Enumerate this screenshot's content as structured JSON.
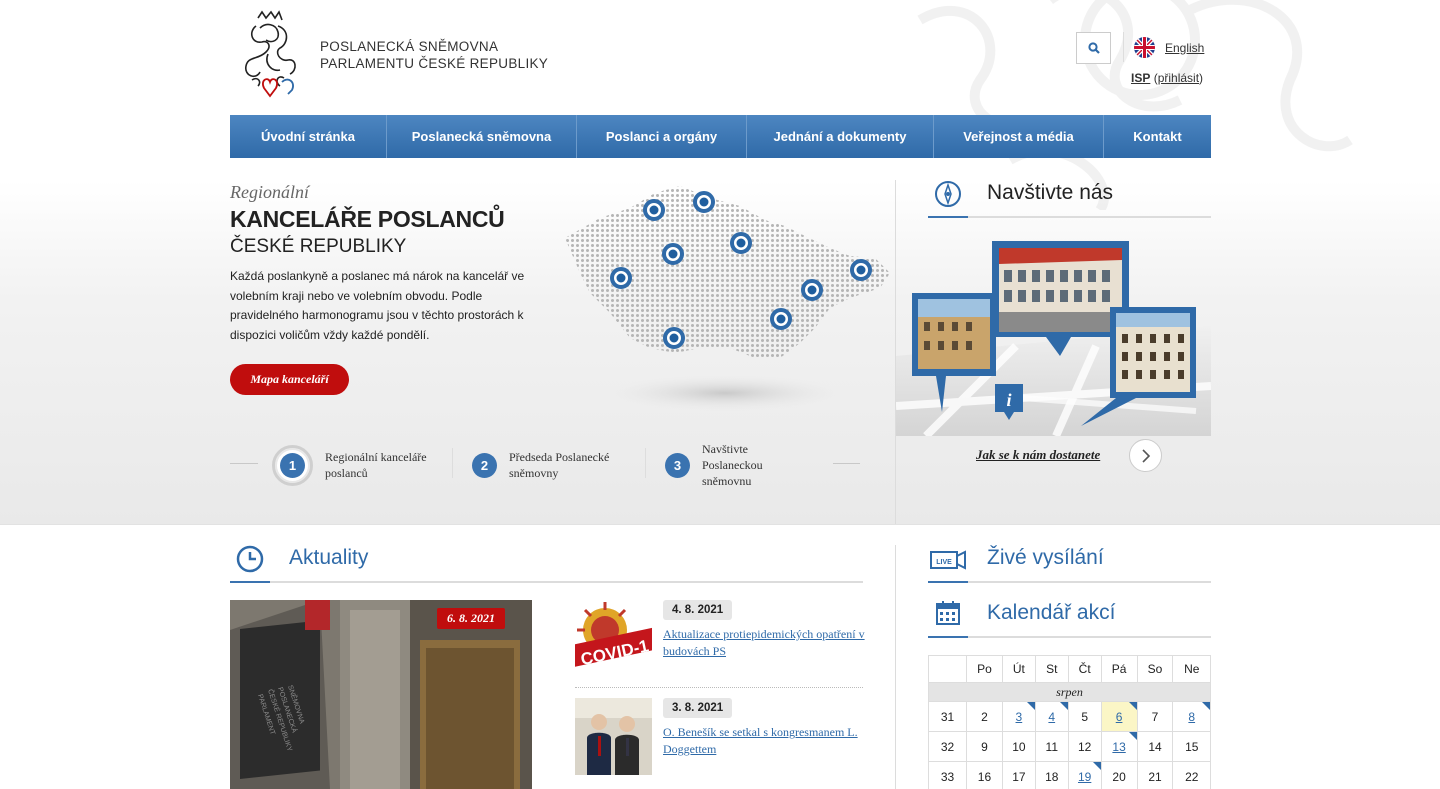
{
  "header": {
    "brand_line1": "POSLANECKÁ SNĚMOVNA",
    "brand_line2": "PARLAMENTU ČESKÉ REPUBLIKY",
    "language_link": "English",
    "isp_label": "ISP",
    "isp_login": "přihlásit",
    "isp_open": "(",
    "isp_close": ")"
  },
  "nav": {
    "items": [
      {
        "label": "Úvodní stránka"
      },
      {
        "label": "Poslanecká sněmovna"
      },
      {
        "label": "Poslanci a orgány"
      },
      {
        "label": "Jednání a dokumenty"
      },
      {
        "label": "Veřejnost a média"
      },
      {
        "label": "Kontakt"
      }
    ]
  },
  "hero": {
    "kicker": "Regionální",
    "title": "KANCELÁŘE POSLANCŮ",
    "subtitle": "ČESKÉ REPUBLIKY",
    "text": "Každá poslankyně a poslanec má nárok na kancelář ve volebním kraji nebo ve volebním obvodu. Podle pravidelného harmonogramu jsou v těchto prostorách k dispozici voličům vždy každé pondělí.",
    "button": "Mapa kanceláří",
    "steps": [
      {
        "num": "1",
        "label": "Regionální kanceláře poslanců"
      },
      {
        "num": "2",
        "label": "Předseda Poslanecké sněmovny"
      },
      {
        "num": "3",
        "label": "Navštivte Poslaneckou sněmovnu"
      }
    ]
  },
  "visit": {
    "title": "Navštivte nás",
    "link": "Jak se k nám dostanete"
  },
  "news": {
    "title": "Aktuality",
    "featured_date": "6. 8. 2021",
    "items": [
      {
        "date": "4. 8. 2021",
        "title": "Aktualizace protiepidemických opatření v budovách PS",
        "thumb_text": "COVID-1"
      },
      {
        "date": "3. 8. 2021",
        "title": "O. Benešík se setkal s kongresmanem L. Doggettem"
      }
    ]
  },
  "live": {
    "title": "Živé vysílání",
    "icon_text": "LIVE"
  },
  "calendar": {
    "title": "Kalendář akcí",
    "days": [
      "Po",
      "Út",
      "St",
      "Čt",
      "Pá",
      "So",
      "Ne"
    ],
    "month": "srpen",
    "weeks": [
      {
        "wk": "31",
        "d": [
          "2",
          "3",
          "4",
          "5",
          "6",
          "7",
          "8"
        ]
      },
      {
        "wk": "32",
        "d": [
          "9",
          "10",
          "11",
          "12",
          "13",
          "14",
          "15"
        ]
      },
      {
        "wk": "33",
        "d": [
          "16",
          "17",
          "18",
          "19",
          "20",
          "21",
          "22"
        ]
      }
    ]
  },
  "colors": {
    "primary": "#2f6aa8",
    "accent_red": "#c00d0d"
  }
}
